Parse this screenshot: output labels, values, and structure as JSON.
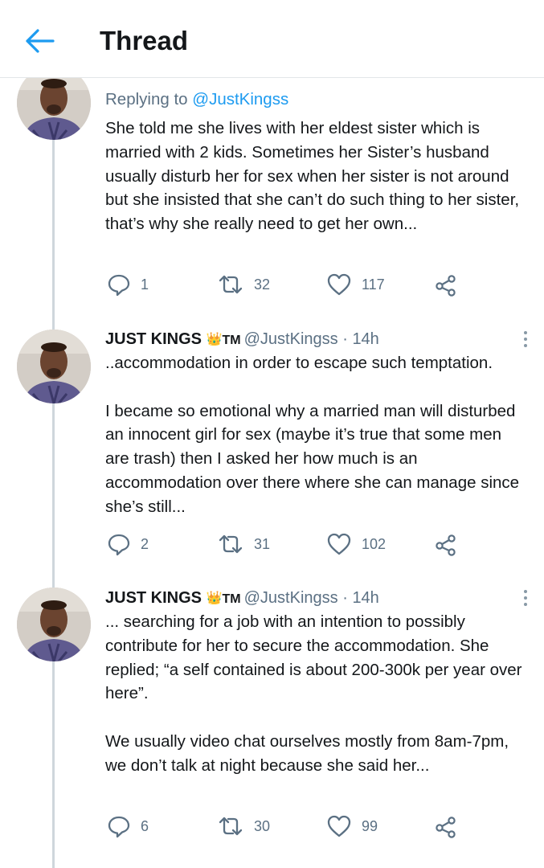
{
  "header": {
    "title": "Thread"
  },
  "tweets": [
    {
      "replying_prefix": "Replying to ",
      "replying_to": "@JustKingss",
      "text": "She told me she lives with her eldest sister which is married with 2 kids. Sometimes her Sister’s husband usually disturb her for sex when her sister is not around but she insisted that she can’t do such thing to her sister, that’s why she really need to get her own...",
      "replies": "1",
      "retweets": "32",
      "likes": "117"
    },
    {
      "name": "JUST KINGS",
      "tm": "TM",
      "handle": "@JustKingss",
      "dot": "·",
      "time": "14h",
      "text": "..accommodation in order to escape such temptation.\n\nI became so emotional why a married man will disturbed an innocent girl for sex (maybe it’s true that some men are trash) then I asked her how much is an accommodation over there where she can manage since she’s still...",
      "replies": "2",
      "retweets": "31",
      "likes": "102"
    },
    {
      "name": "JUST KINGS",
      "tm": "TM",
      "handle": "@JustKingss",
      "dot": "·",
      "time": "14h",
      "text": "... searching for a job with an intention to possibly contribute for her to secure the accommodation. She replied; “a self contained is about 200-300k per year over here”.\n\nWe usually video chat ourselves mostly from 8am-7pm, we don’t talk at night because she said her...",
      "replies": "6",
      "retweets": "30",
      "likes": "99"
    }
  ],
  "icons": {
    "back": "arrow-left-icon",
    "reply": "reply-bubble-icon",
    "retweet": "retweet-icon",
    "like": "heart-icon",
    "share": "share-icon",
    "more": "more-vertical-icon",
    "badge": "crown-emoji-icon"
  },
  "colors": {
    "accent": "#1d9bf0",
    "muted": "#5b7083",
    "text": "#14171a"
  }
}
